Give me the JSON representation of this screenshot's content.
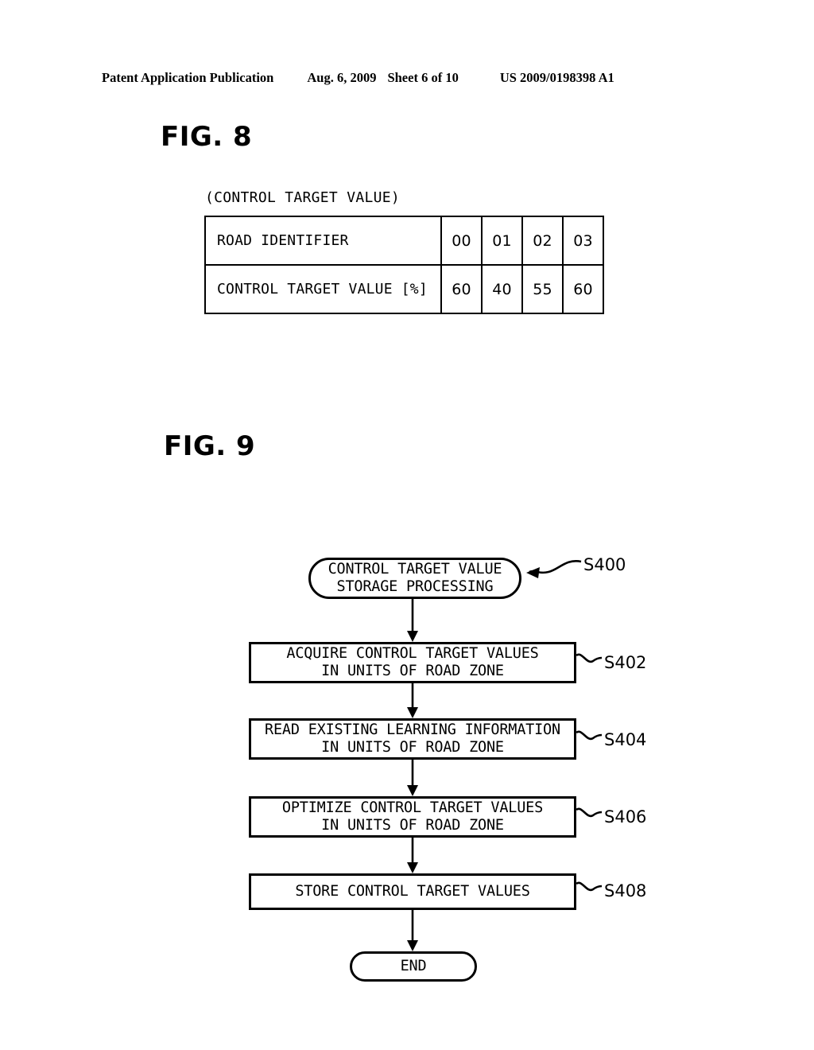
{
  "header": {
    "left": "Patent Application Publication",
    "date": "Aug. 6, 2009",
    "sheet": "Sheet 6 of 10",
    "number": "US 2009/0198398 A1"
  },
  "fig8": {
    "caption": "FIG. 8",
    "title": "(CONTROL TARGET VALUE)",
    "rows": [
      {
        "label": "ROAD IDENTIFIER",
        "values": [
          "00",
          "01",
          "02",
          "03"
        ]
      },
      {
        "label": "CONTROL TARGET VALUE [%]",
        "values": [
          "60",
          "40",
          "55",
          "60"
        ]
      }
    ]
  },
  "fig9": {
    "caption": "FIG. 9",
    "nodes": [
      {
        "id": "S400",
        "type": "terminal",
        "line1": "CONTROL TARGET VALUE",
        "line2": "STORAGE PROCESSING",
        "label": "S400"
      },
      {
        "id": "S402",
        "type": "process",
        "line1": "ACQUIRE CONTROL TARGET VALUES",
        "line2": "IN UNITS OF ROAD ZONE",
        "label": "S402"
      },
      {
        "id": "S404",
        "type": "process",
        "line1": "READ EXISTING LEARNING INFORMATION",
        "line2": "IN UNITS OF ROAD ZONE",
        "label": "S404"
      },
      {
        "id": "S406",
        "type": "process",
        "line1": "OPTIMIZE CONTROL TARGET VALUES",
        "line2": "IN UNITS OF ROAD ZONE",
        "label": "S406"
      },
      {
        "id": "S408",
        "type": "process",
        "line1": "STORE CONTROL TARGET VALUES",
        "line2": "",
        "label": "S408"
      },
      {
        "id": "END",
        "type": "terminal",
        "line1": "END",
        "line2": "",
        "label": ""
      }
    ]
  },
  "colors": {
    "ink": "#000000",
    "paper": "#ffffff"
  }
}
